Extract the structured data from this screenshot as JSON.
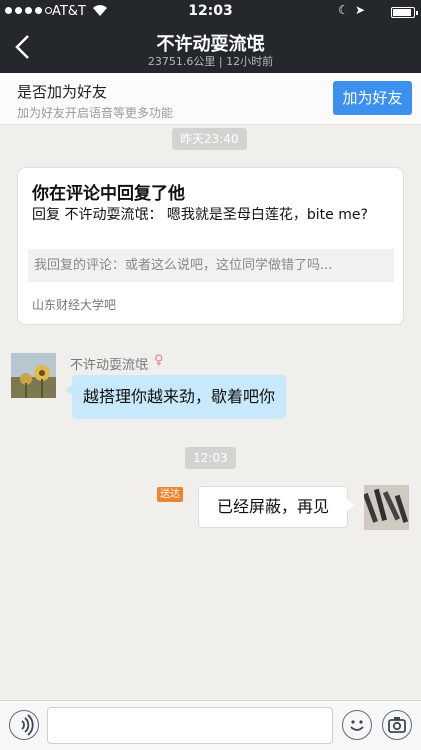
{
  "status_bar": {
    "carrier": "AT&T",
    "time": "12:03"
  },
  "nav": {
    "title": "不许动耍流氓",
    "subtitle": "23751.6公里 | 12小时前"
  },
  "friend_bar": {
    "title": "是否加为好友",
    "subtitle": "加为好友开启语音等更多功能",
    "button_label": "加为好友"
  },
  "timestamps": {
    "first": "昨天23:40",
    "second": "12:03"
  },
  "card": {
    "title": "你在评论中回复了他",
    "body": "回复 不许动耍流氓： 嗯我就是圣母白莲花，bite me?",
    "quote": "我回复的评论：或者这么说吧，这位同学做错了吗...",
    "source": "山东财经大学吧"
  },
  "incoming": {
    "sender": "不许动耍流氓",
    "gender_symbol": "♀",
    "text": "越搭理你越来劲，歇着吧你"
  },
  "outgoing": {
    "status": "送达",
    "text": "已经屏蔽，再见"
  },
  "input_bar": {
    "placeholder": "",
    "icons": [
      "voice-icon",
      "emoji-icon",
      "camera-icon"
    ]
  },
  "colors": {
    "nav_bg": "#24282d",
    "accent": "#3c91f0",
    "incoming_bubble": "#c8e8fb",
    "sent_tag": "#f0852f",
    "chat_bg": "#f1efec"
  }
}
